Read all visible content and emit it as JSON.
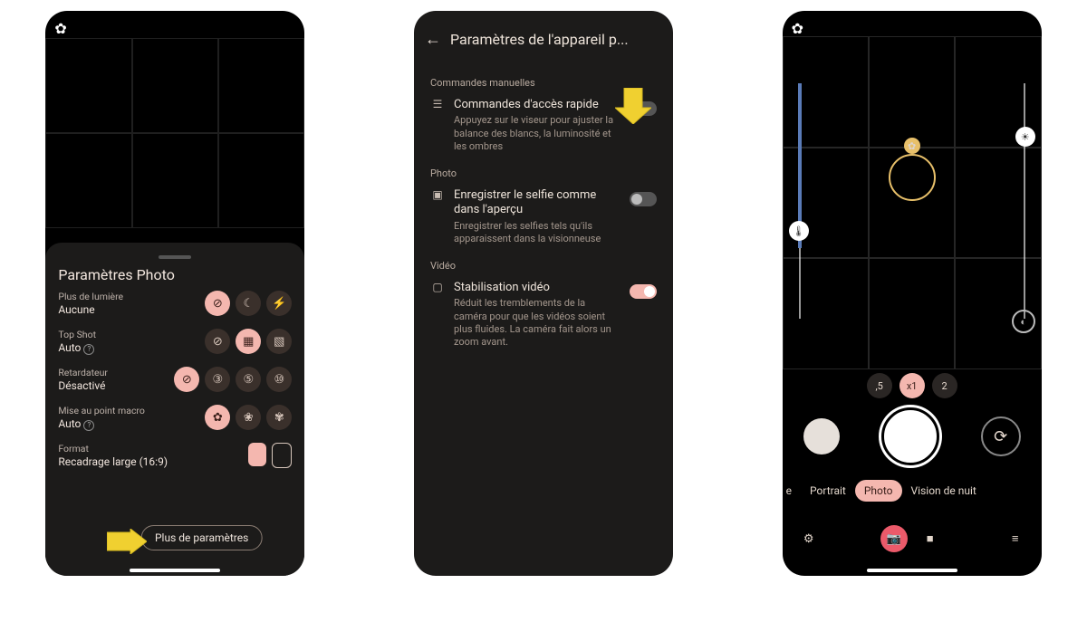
{
  "screen1": {
    "sheet_title": "Paramètres Photo",
    "light": {
      "label": "Plus de lumière",
      "value": "Aucune"
    },
    "topshot": {
      "label": "Top Shot",
      "value": "Auto"
    },
    "timer": {
      "label": "Retardateur",
      "value": "Désactivé"
    },
    "macro": {
      "label": "Mise au point macro",
      "value": "Auto"
    },
    "format": {
      "label": "Format",
      "value": "Recadrage large (16:9)"
    },
    "more_button": "Plus de paramètres"
  },
  "screen2": {
    "title": "Paramètres de l'appareil p...",
    "section_manual": "Commandes manuelles",
    "quick": {
      "title": "Commandes d'accès rapide",
      "desc": "Appuyez sur le viseur pour ajuster la balance des blancs, la luminosité et les ombres",
      "on": false
    },
    "section_photo": "Photo",
    "selfie": {
      "title": "Enregistrer le selfie comme dans l'aperçu",
      "desc": "Enregistrer les selfies tels qu'ils apparaissent dans la visionneuse",
      "on": false
    },
    "section_video": "Vidéo",
    "stab": {
      "title": "Stabilisation vidéo",
      "desc": "Réduit les tremblements de la caméra pour que les vidéos soient plus fluides. La caméra fait alors un zoom avant.",
      "on": true
    }
  },
  "screen3": {
    "zoom": {
      "options": [
        ",5",
        "x1",
        "2"
      ],
      "active": "x1"
    },
    "modes": {
      "left_cut": "e",
      "portrait": "Portrait",
      "photo": "Photo",
      "night": "Vision de nuit"
    }
  }
}
